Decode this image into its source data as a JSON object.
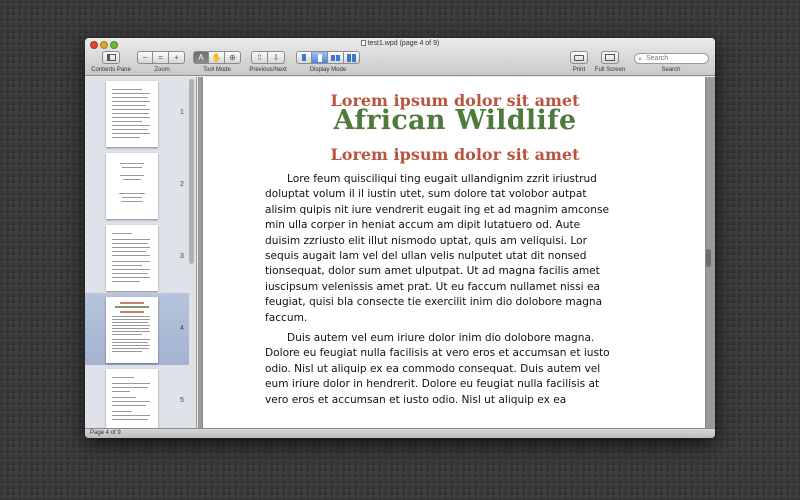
{
  "window": {
    "title": "test1.wpd (page 4 of 9)"
  },
  "toolbar": {
    "contents_pane_label": "Contents Pane",
    "zoom_label": "Zoom",
    "tool_mode_label": "Tool Mode",
    "prev_next_label": "Previous/Next",
    "display_mode_label": "Display Mode",
    "print_label": "Print",
    "full_screen_label": "Full Screen",
    "search_label": "Search",
    "search_placeholder": "Search"
  },
  "icons": {
    "zoom_out": "−",
    "zoom_fit": "=",
    "zoom_in": "+",
    "tool_text": "A",
    "tool_hand": "✋",
    "tool_zoom": "⊕",
    "prev": "⇧",
    "next": "⇩",
    "search_glyph": "⌕"
  },
  "sidebar": {
    "pages": [
      "1",
      "2",
      "3",
      "4",
      "5"
    ],
    "selected_page": "4"
  },
  "document": {
    "heading_top": "Lorem ipsum dolor sit amet",
    "title": "African Wildlife",
    "heading_sub": "Lorem ipsum dolor sit amet",
    "paragraph1": "Lore feum quisciliqui ting eugait ullandignim zzrit iriustrud\ndoluptat volum il il iustin utet, sum dolore tat volobor autpat\nalisim quipis nit iure vendrerit eugait ing et ad magnim amconse\nmin ulla corper in heniat accum am dipit lutatuero od. Aute\nduisim zzriusto elit illut nismodo uptat, quis am veliquisi. Lor\nsequis augait lam vel del ullan velis nulputet utat dit nonsed\ntionsequat, dolor sum amet ulputpat. Ut ad magna facilis amet\niuscipsum velenissis amet prat. Ut eu faccum nullamet nissi ea\nfeugiat, quisi bla consecte tie exercilit inim dio dolobore magna\nfaccum.",
    "paragraph2": "Duis autem vel eum iriure dolor inim dio dolobore magna.\nDolore eu feugiat nulla facilisis at vero eros et accumsan et iusto\nodio. Nisl ut aliquip ex ea commodo consequat. Duis autem vel\neum iriure dolor in hendrerit. Dolore eu feugiat nulla facilisis at\nvero eros et accumsan et iusto odio. Nisl ut aliquip ex ea"
  },
  "status": {
    "page_info": "Page 4 of 9"
  },
  "colors": {
    "heading_red": "#b9553f",
    "title_green": "#4e7a3c",
    "selection_blue": "#a3b3d0"
  }
}
